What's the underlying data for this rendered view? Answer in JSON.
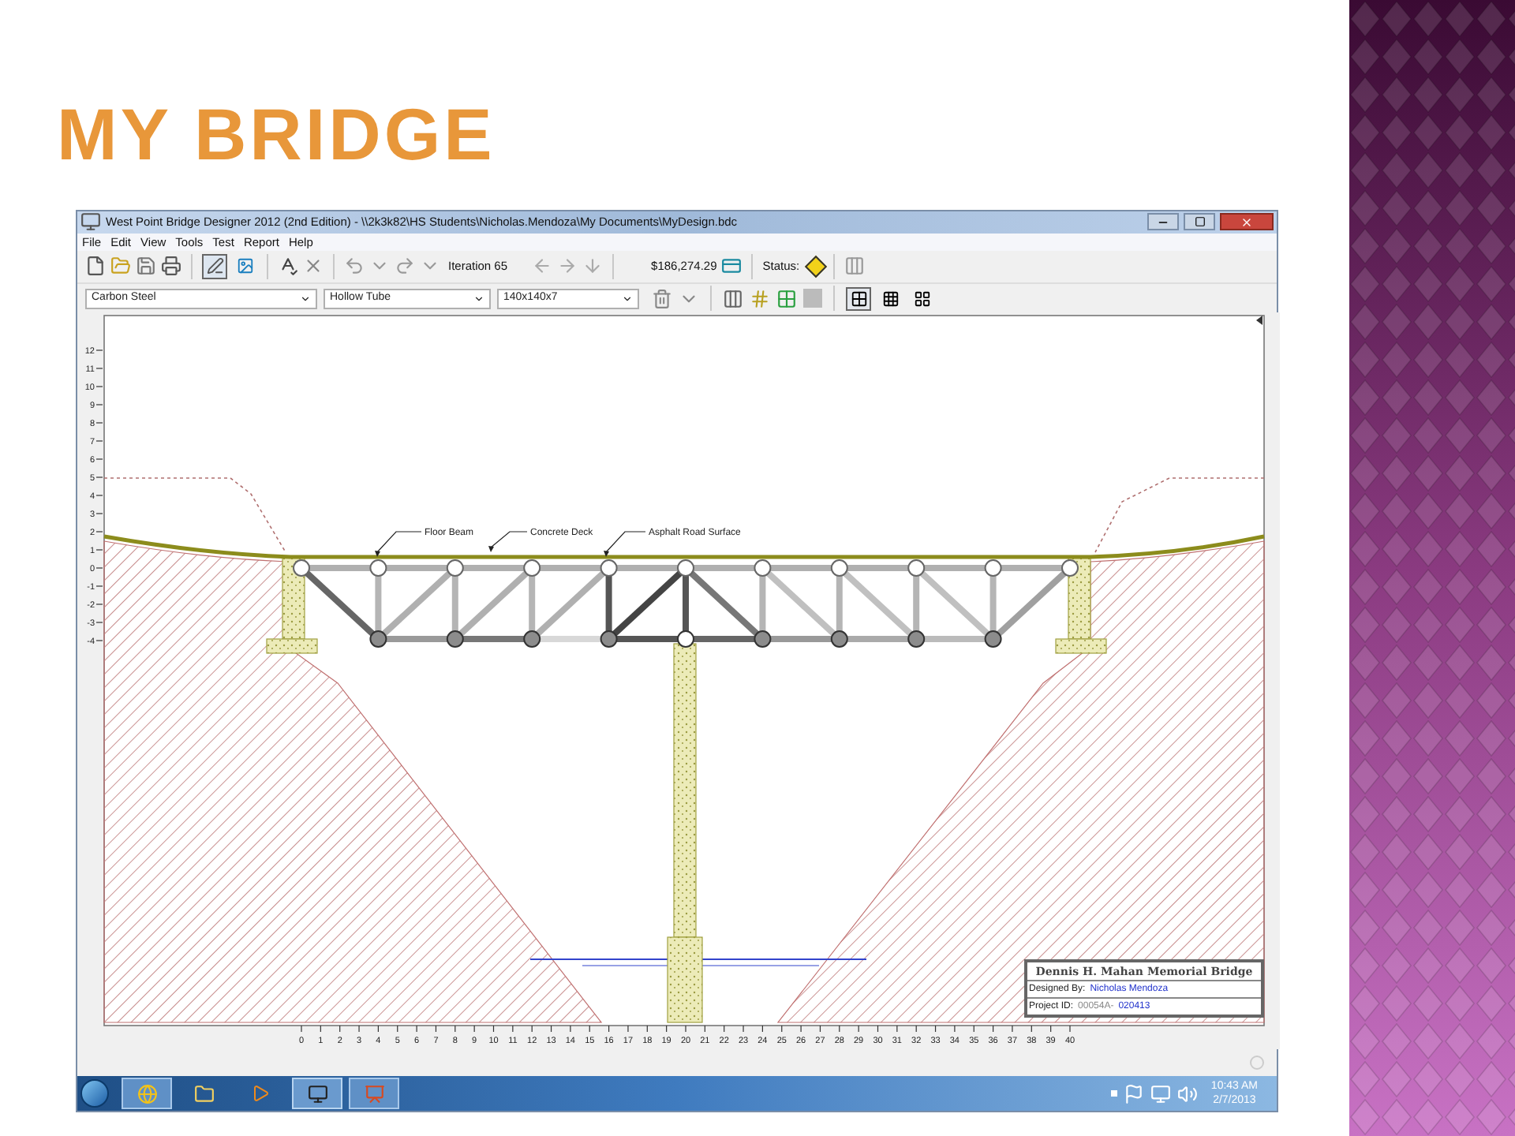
{
  "slide": {
    "title": "MY BRIDGE"
  },
  "window": {
    "title": "West Point Bridge Designer 2012 (2nd Edition) - \\\\2k3k82\\HS Students\\Nicholas.Mendoza\\My Documents\\MyDesign.bdc",
    "menu": [
      "File",
      "Edit",
      "View",
      "Tools",
      "Test",
      "Report",
      "Help"
    ]
  },
  "toolbar": {
    "drawing_tools": [
      {
        "selected": true
      },
      {
        "selected": false
      }
    ],
    "iteration": "Iteration 65",
    "cost": "$186,274.29",
    "status_label": "Status:"
  },
  "selectors": {
    "material": "Carbon Steel",
    "section": "Hollow Tube",
    "size": "140x140x7"
  },
  "grid_buttons": [
    {
      "selected": true
    },
    {
      "selected": false
    },
    {
      "selected": false
    }
  ],
  "canvas": {
    "vertical_ruler": [
      "12",
      "11",
      "10",
      "9",
      "8",
      "7",
      "6",
      "5",
      "4",
      "3",
      "2",
      "1",
      "0",
      "-1",
      "-2",
      "-3",
      "-4"
    ],
    "horizontal_ruler": [
      "0",
      "1",
      "2",
      "3",
      "4",
      "5",
      "6",
      "7",
      "8",
      "9",
      "10",
      "11",
      "12",
      "13",
      "14",
      "15",
      "16",
      "17",
      "18",
      "19",
      "20",
      "21",
      "22",
      "23",
      "24",
      "25",
      "26",
      "27",
      "28",
      "29",
      "30",
      "31",
      "32",
      "33",
      "34",
      "35",
      "36",
      "37",
      "38",
      "39",
      "40"
    ],
    "callouts": [
      "Floor Beam",
      "Concrete Deck",
      "Asphalt Road Surface"
    ]
  },
  "title_block": {
    "name": "Dennis H. Mahan Memorial Bridge",
    "designed_by_label": "Designed By:",
    "designer": "Nicholas Mendoza",
    "project_id_label": "Project ID:",
    "project_id_prefix": "00054A-",
    "project_id": "020413"
  },
  "taskbar": {
    "time": "10:43 AM",
    "date": "2/7/2013"
  }
}
